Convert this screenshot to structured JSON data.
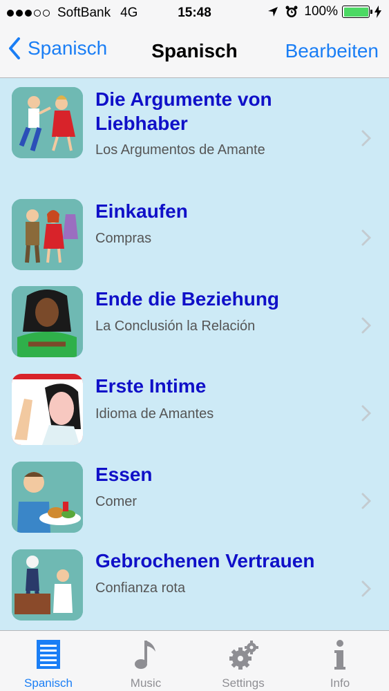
{
  "status": {
    "carrier": "SoftBank",
    "network": "4G",
    "time": "15:48",
    "battery": "100%",
    "battery_level": 1.0,
    "signal_bars": 3,
    "signal_total": 5
  },
  "nav": {
    "back_label": "Spanisch",
    "title": "Spanisch",
    "edit_label": "Bearbeiten"
  },
  "items": [
    {
      "title": "Die Argumente von Liebhaber",
      "subtitle": "Los Argumentos de Amante"
    },
    {
      "title": "Einkaufen",
      "subtitle": "Compras"
    },
    {
      "title": "Ende die Beziehung",
      "subtitle": "La Conclusión la Relación"
    },
    {
      "title": "Erste Intime",
      "subtitle": "Idioma de Amantes"
    },
    {
      "title": "Essen",
      "subtitle": "Comer"
    },
    {
      "title": "Gebrochenen Vertrauen",
      "subtitle": "Confianza rota"
    }
  ],
  "tabs": [
    {
      "label": "Spanisch",
      "icon": "list-document-icon",
      "active": true
    },
    {
      "label": "Music",
      "icon": "music-note-icon",
      "active": false
    },
    {
      "label": "Settings",
      "icon": "gear-icon",
      "active": false
    },
    {
      "label": "Info",
      "icon": "info-icon",
      "active": false
    }
  ],
  "colors": {
    "accent": "#1a7ef5",
    "title_text": "#1010c8",
    "list_background": "#cdeaf6",
    "battery_green": "#4cd964"
  }
}
